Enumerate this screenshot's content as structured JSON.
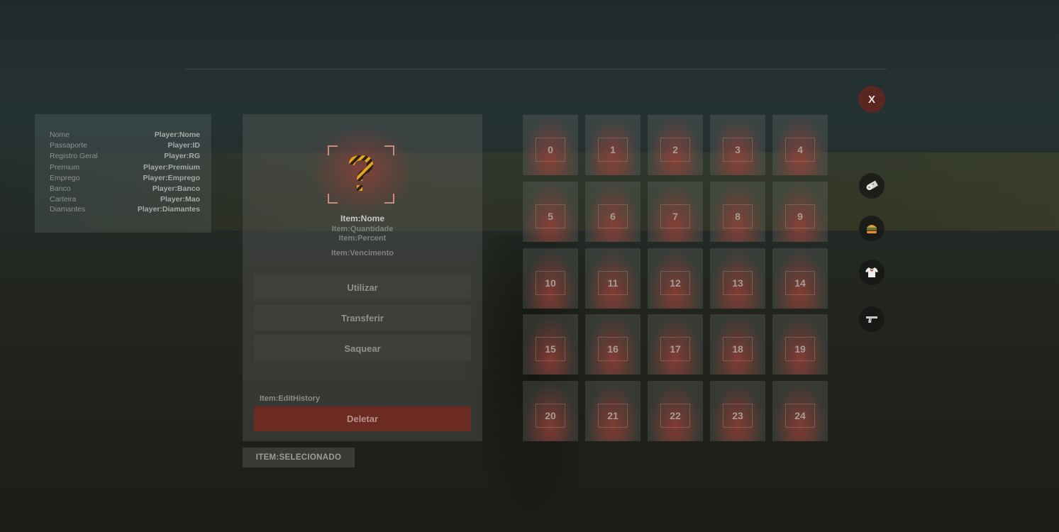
{
  "window": {
    "close_label": "X"
  },
  "player": {
    "rows": [
      {
        "label": "Nome",
        "value": "Player:Nome"
      },
      {
        "label": "Passaporte",
        "value": "Player:ID"
      },
      {
        "label": "Registro Geral",
        "value": "Player:RG"
      },
      {
        "label": "Premium",
        "value": "Player:Premium"
      },
      {
        "label": "Emprego",
        "value": "Player:Emprego"
      },
      {
        "label": "Banco",
        "value": "Player:Banco"
      },
      {
        "label": "Carteira",
        "value": "Player:Mao"
      },
      {
        "label": "Diamantes",
        "value": "Player:Diamantes"
      }
    ]
  },
  "item": {
    "icon": "question-mark-icon",
    "name": "Item:Nome",
    "quantity": "Item:Quantidade",
    "percent": "Item:Percent",
    "expiry": "Item:Vencimento",
    "use_label": "Utilizar",
    "transfer_label": "Transferir",
    "loot_label": "Saquear",
    "history": "Item:EditHistory",
    "delete_label": "Deletar",
    "selected_tag": "ITEM:SELECIONADO"
  },
  "slots": [
    "0",
    "1",
    "2",
    "3",
    "4",
    "5",
    "6",
    "7",
    "8",
    "9",
    "10",
    "11",
    "12",
    "13",
    "14",
    "15",
    "16",
    "17",
    "18",
    "19",
    "20",
    "21",
    "22",
    "23",
    "24"
  ],
  "categories": [
    {
      "name": "pill-icon"
    },
    {
      "name": "burger-icon"
    },
    {
      "name": "shirt-icon"
    },
    {
      "name": "pistol-icon"
    }
  ],
  "colors": {
    "accent": "#6b2a22",
    "close": "#5a2620",
    "slot_glow": "#be3c32"
  }
}
